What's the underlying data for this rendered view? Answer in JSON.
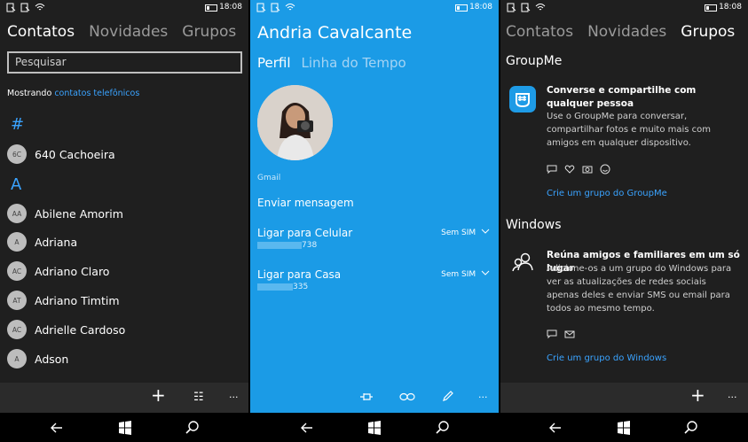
{
  "status": {
    "time": "18:08"
  },
  "contacts": {
    "tabs": [
      "Contatos",
      "Novidades",
      "Grupos"
    ],
    "search_placeholder": "Pesquisar",
    "showing_prefix": "Mostrando",
    "showing_link": "contatos telefônicos",
    "sections": [
      {
        "header": "#",
        "items": [
          {
            "initials": "6C",
            "name": "640 Cachoeira"
          }
        ]
      },
      {
        "header": "A",
        "items": [
          {
            "initials": "AA",
            "name": "Abilene Amorim"
          },
          {
            "initials": "A",
            "name": "Adriana"
          },
          {
            "initials": "AC",
            "name": "Adriano Claro"
          },
          {
            "initials": "AT",
            "name": "Adriano Timtim"
          },
          {
            "initials": "AC",
            "name": "Adrielle Cardoso"
          },
          {
            "initials": "A",
            "name": "Adson"
          }
        ]
      }
    ],
    "appbar": {
      "add": "+",
      "select": "☷",
      "more": "···"
    }
  },
  "profile": {
    "name": "Andria Cavalcante",
    "tabs": [
      "Perfil",
      "Linha do Tempo"
    ],
    "source": "Gmail",
    "send_message": "Enviar mensagem",
    "calls": [
      {
        "label": "Ligar para Celular",
        "number_suffix": "738",
        "sim": "Sem SIM"
      },
      {
        "label": "Ligar para Casa",
        "number_suffix": "335",
        "sim": "Sem SIM"
      }
    ],
    "appbar": {
      "more": "···"
    }
  },
  "groups": {
    "tabs": [
      "Contatos",
      "Novidades",
      "Grupos"
    ],
    "groupme": {
      "section": "GroupMe",
      "title": "Converse e compartilhe com qualquer pessoa",
      "desc": "Use o GroupMe para conversar, compartilhar fotos e muito mais com amigos em qualquer dispositivo.",
      "link": "Crie um grupo do GroupMe"
    },
    "windows": {
      "section": "Windows",
      "title": "Reúna amigos e familiares em um só lugar",
      "desc": "Adicione-os a um grupo do Windows para ver as atualizações de redes sociais apenas deles e enviar SMS ou email para todos ao mesmo tempo.",
      "link": "Crie um grupo do Windows"
    },
    "appbar": {
      "add": "+",
      "more": "···"
    }
  },
  "colors": {
    "accent": "#1b9be6",
    "link": "#3aa3ff",
    "dark_bg": "#1f1f1f"
  }
}
